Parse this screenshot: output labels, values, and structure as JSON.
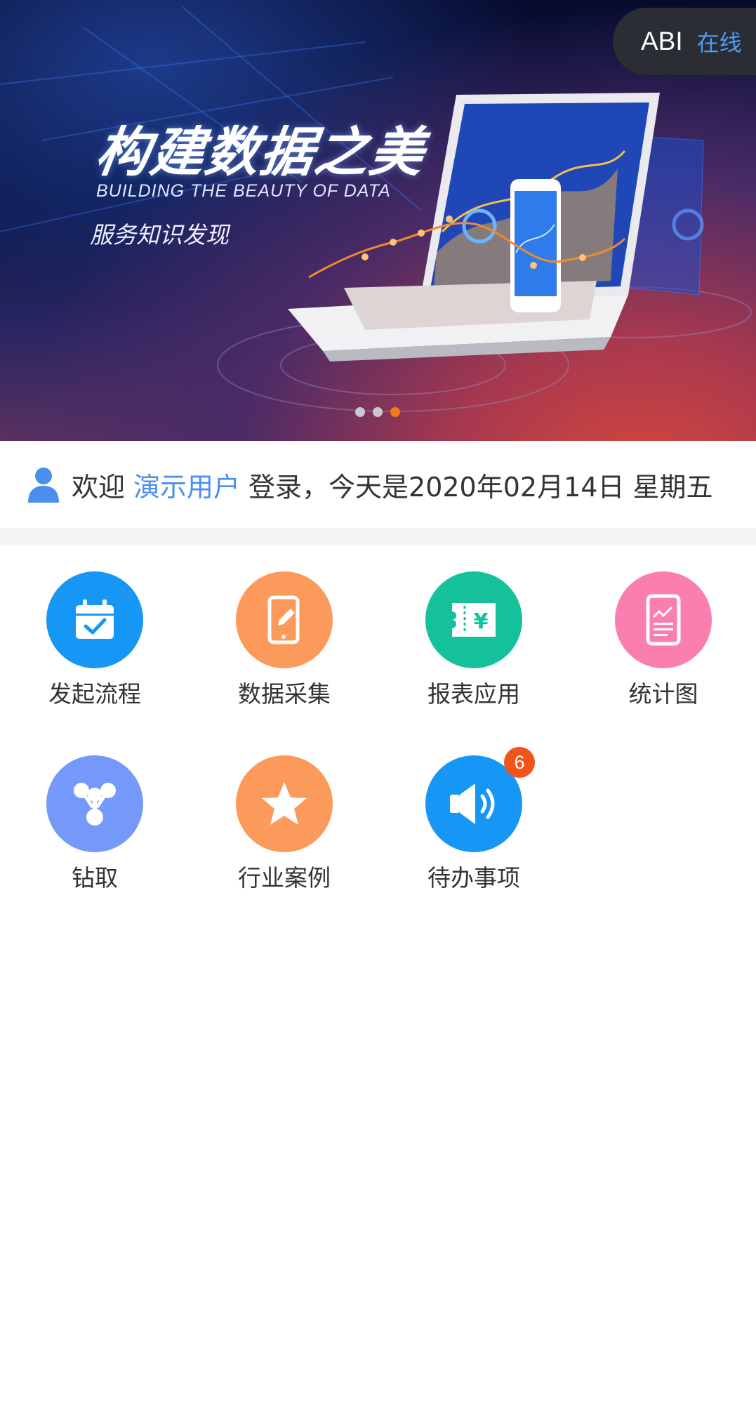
{
  "banner": {
    "title": "构建数据之美",
    "subtitle": "BUILDING THE BEAUTY OF DATA",
    "tagline": "服务知识发现",
    "slides": 3,
    "active_slide": 3
  },
  "header_pill": {
    "brand": "ABI",
    "status": "在线"
  },
  "welcome": {
    "prefix": "欢迎",
    "user": "演示用户",
    "suffix": "登录，今天是2020年02月14日 星期五"
  },
  "tiles": [
    {
      "label": "发起流程",
      "icon": "calendar-check-icon",
      "color": "#1696f5"
    },
    {
      "label": "数据采集",
      "icon": "phone-edit-icon",
      "color": "#fb9a5a"
    },
    {
      "label": "报表应用",
      "icon": "yuan-receipt-icon",
      "color": "#15c19a"
    },
    {
      "label": "统计图",
      "icon": "phone-chart-icon",
      "color": "#fb7fae"
    },
    {
      "label": "钻取",
      "icon": "molecule-icon",
      "color": "#7499fb"
    },
    {
      "label": "行业案例",
      "icon": "star-icon",
      "color": "#fb9a5a"
    },
    {
      "label": "待办事项",
      "icon": "speaker-icon",
      "color": "#1696f5",
      "badge": "6"
    }
  ]
}
